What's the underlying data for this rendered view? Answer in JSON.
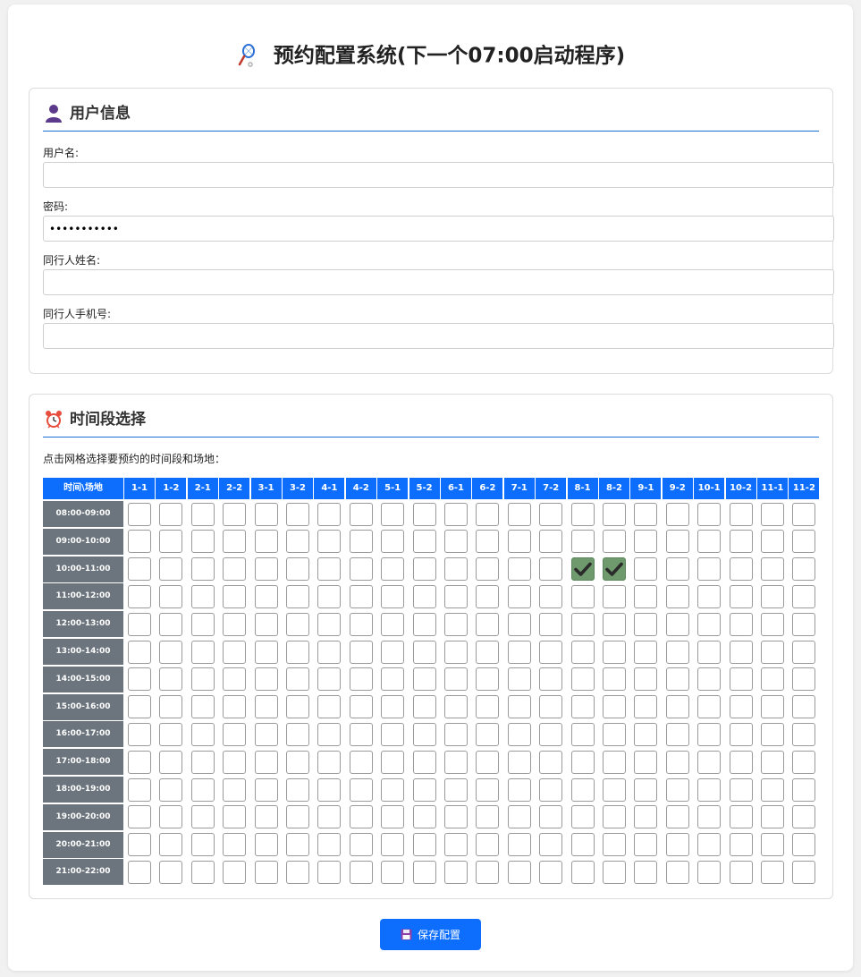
{
  "title": "预约配置系统(下一个07:00启动程序)",
  "title_icon": "badminton-racket-icon",
  "user_section": {
    "title": "用户信息",
    "icon": "user-silhouette-icon",
    "fields": [
      {
        "label": "用户名:",
        "value": "",
        "type": "text"
      },
      {
        "label": "密码:",
        "value": "•••••••••••",
        "type": "password"
      },
      {
        "label": "同行人姓名:",
        "value": "",
        "type": "text"
      },
      {
        "label": "同行人手机号:",
        "value": "",
        "type": "text"
      }
    ]
  },
  "time_section": {
    "title": "时间段选择",
    "icon": "alarm-clock-icon",
    "hint": "点击网格选择要预约的时间段和场地：",
    "corner_label": "时间\\场地",
    "courts": [
      "1-1",
      "1-2",
      "2-1",
      "2-2",
      "3-1",
      "3-2",
      "4-1",
      "4-2",
      "5-1",
      "5-2",
      "6-1",
      "6-2",
      "7-1",
      "7-2",
      "8-1",
      "8-2",
      "9-1",
      "9-2",
      "10-1",
      "10-2",
      "11-1",
      "11-2"
    ],
    "time_slots": [
      "08:00-09:00",
      "09:00-10:00",
      "10:00-11:00",
      "11:00-12:00",
      "12:00-13:00",
      "13:00-14:00",
      "14:00-15:00",
      "15:00-16:00",
      "16:00-17:00",
      "17:00-18:00",
      "18:00-19:00",
      "19:00-20:00",
      "20:00-21:00",
      "21:00-22:00"
    ],
    "selected": [
      {
        "time": "10:00-11:00",
        "court": "8-1"
      },
      {
        "time": "10:00-11:00",
        "court": "8-2"
      }
    ]
  },
  "save_button": {
    "label": "保存配置",
    "icon": "floppy-disk-icon"
  },
  "colors": {
    "accent": "#0d6efd",
    "row_label_bg": "#6c757d",
    "checked_cell": "#6e9a6e",
    "divider": "#1a6fd6"
  }
}
